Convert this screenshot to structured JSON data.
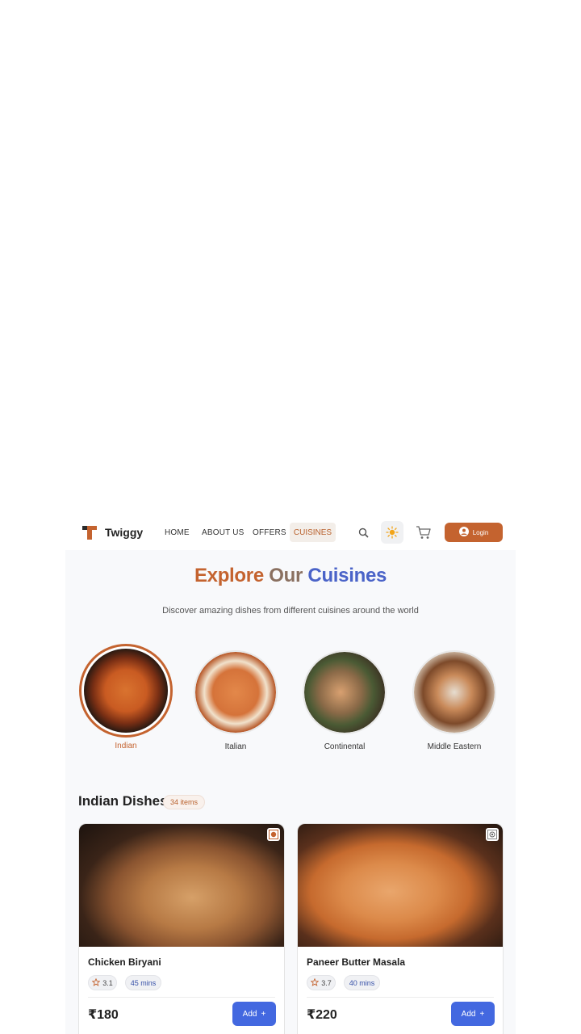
{
  "nav": {
    "brand": "Twiggy",
    "links": [
      "HOME",
      "ABOUT US",
      "OFFERS"
    ],
    "active_link": "CUISINES",
    "login_label": "Login",
    "icons": [
      "search-icon",
      "sun-icon",
      "cart-icon",
      "user-icon"
    ]
  },
  "hero": {
    "title_part1": "Explore",
    "title_part2": "Our",
    "title_part3": "Cuisines",
    "subtitle": "Discover amazing dishes from different cuisines around the world"
  },
  "cuisines": [
    {
      "label": "Indian",
      "active": true
    },
    {
      "label": "Italian",
      "active": false
    },
    {
      "label": "Continental",
      "active": false
    },
    {
      "label": "Middle Eastern",
      "active": false
    }
  ],
  "section": {
    "title": "Indian Dishes",
    "count": "34 items"
  },
  "dishes": [
    {
      "name": "Chicken Biryani",
      "rating": "3.1",
      "time": "45 mins",
      "price": "₹180",
      "add_label": "Add",
      "marker": "non-veg"
    },
    {
      "name": "Paneer Butter Masala",
      "rating": "3.7",
      "time": "40 mins",
      "price": "₹220",
      "add_label": "Add",
      "marker": "veg"
    }
  ],
  "colors": {
    "accent": "#c4632f",
    "primary": "#4368e0",
    "background": "#f8f9fb"
  }
}
